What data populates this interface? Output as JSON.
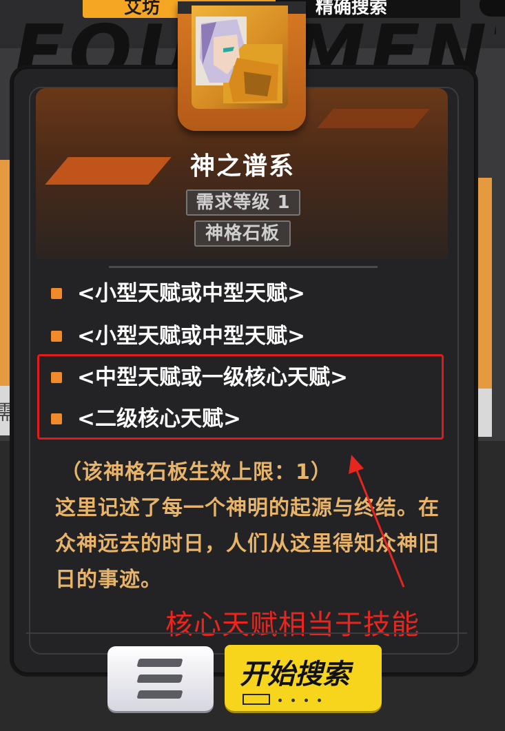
{
  "header_tabs": [
    {
      "label": "艾坊"
    },
    {
      "label": "精确搜索"
    }
  ],
  "background_watermark": "EQUIPMENT",
  "item": {
    "name": "神之谱系",
    "level_requirement": "需求等级 1",
    "type": "神格石板"
  },
  "slots": [
    {
      "label": "<小型天赋或中型天赋>"
    },
    {
      "label": "<小型天赋或中型天赋>"
    },
    {
      "label": "<中型天赋或一级核心天赋>"
    },
    {
      "label": "<二级核心天赋>"
    }
  ],
  "limit_text": "（该神格石板生效上限：1）",
  "lore_text": "这里记述了每一个神明的起源与终结。在众神远去的时日，人们从这里得知众神旧日的事迹。",
  "annotation_text": "核心天赋相当于技能",
  "buttons": {
    "menu_icon": "menu-lines-icon",
    "search_label": "开始搜索"
  },
  "side_card_text": "需",
  "colors": {
    "slot_bullet": "#f08a2b",
    "lore_text": "#e7b46a",
    "annotation_red": "#e8261f",
    "search_button": "#f7d51c"
  }
}
